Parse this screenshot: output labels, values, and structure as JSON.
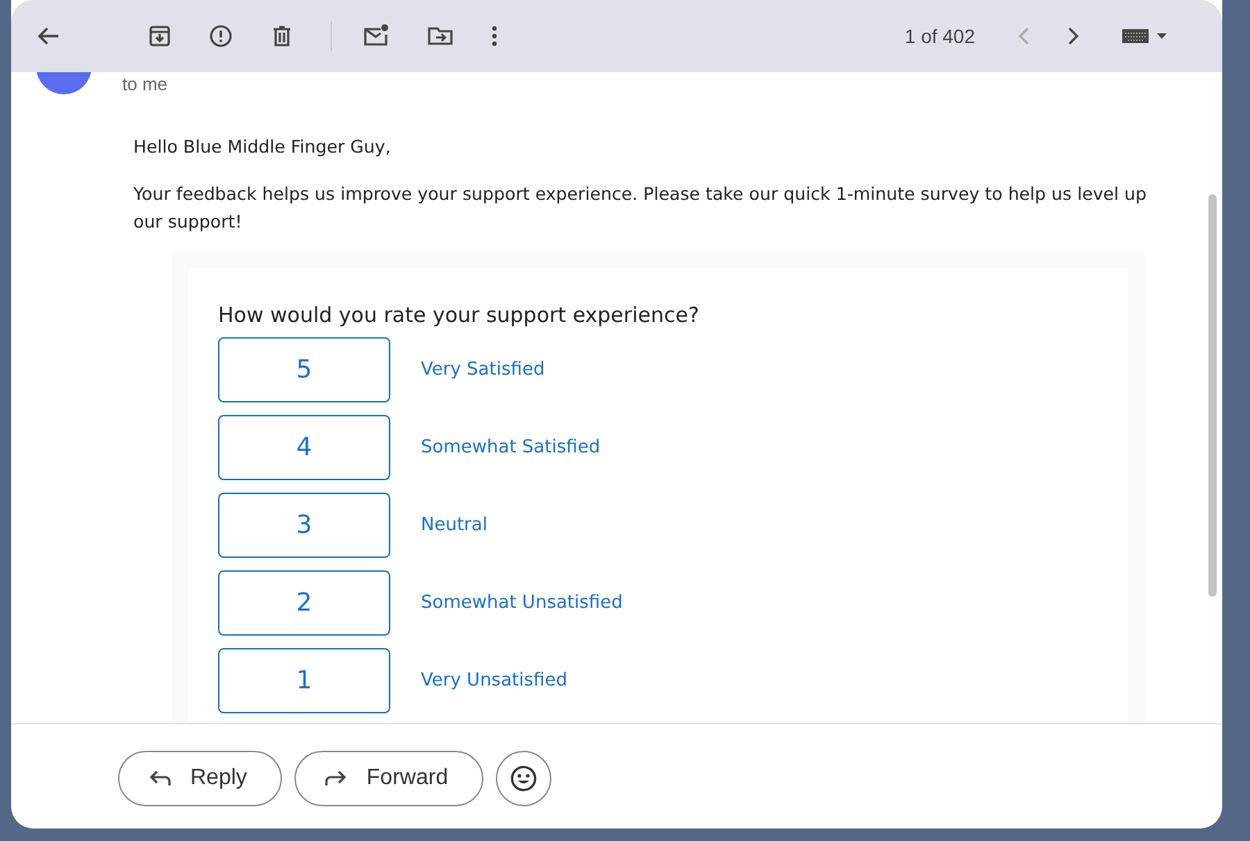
{
  "toolbar": {
    "counter": "1 of 402"
  },
  "message": {
    "recipient": "to me",
    "greeting": "Hello Blue Middle Finger Guy,",
    "body": "Your feedback helps us improve your support experience. Please take our quick 1-minute survey to help us level up our support!"
  },
  "survey": {
    "question": "How would you rate your support experience?",
    "options": [
      {
        "score": "5",
        "label": "Very Satisfied"
      },
      {
        "score": "4",
        "label": "Somewhat Satisfied"
      },
      {
        "score": "3",
        "label": "Neutral"
      },
      {
        "score": "2",
        "label": "Somewhat Unsatisfied"
      },
      {
        "score": "1",
        "label": "Very Unsatisfied"
      }
    ]
  },
  "actions": [
    {
      "kind": "reply",
      "label": "Reply"
    },
    {
      "kind": "forward",
      "label": "Forward"
    },
    {
      "kind": "emoji"
    }
  ]
}
